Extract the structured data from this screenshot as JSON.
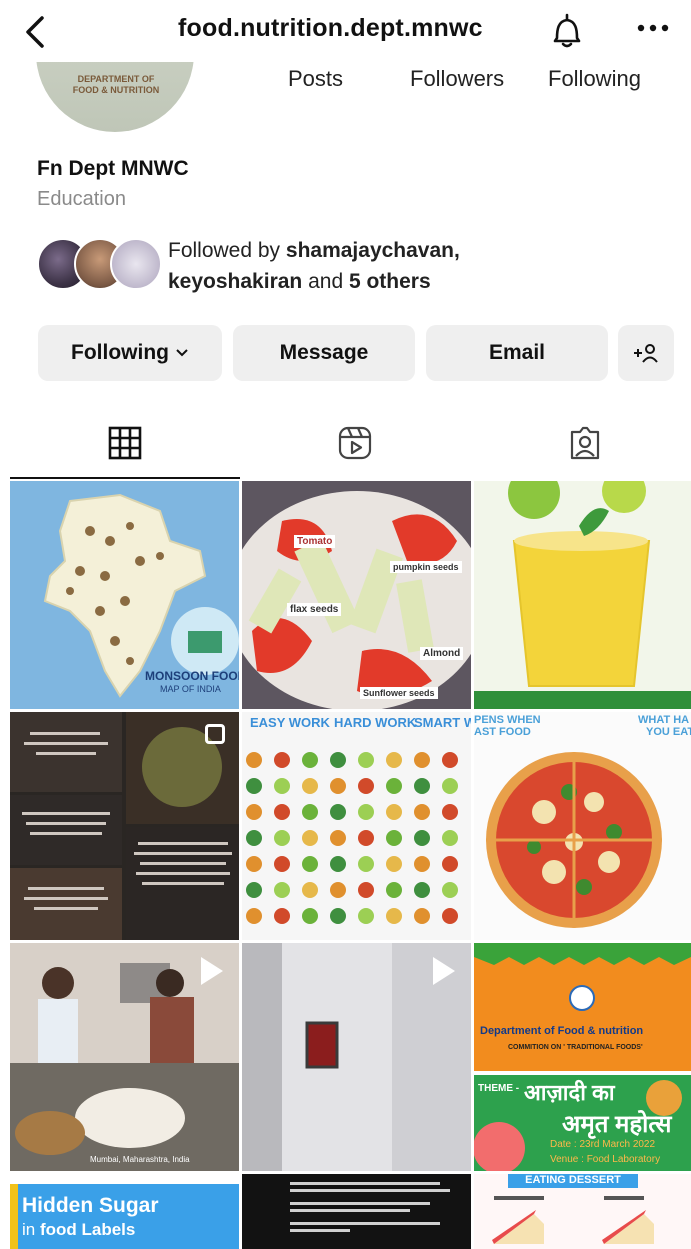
{
  "header": {
    "handle": "food.nutrition.dept.mnwc",
    "back_icon": "chevron-left-icon",
    "bell_icon": "bell-icon",
    "more_icon": "ellipsis-icon"
  },
  "profile": {
    "avatar_text_line1": "DEPARTMENT OF",
    "avatar_text_line2": "FOOD & NUTRITION",
    "stats": {
      "posts_label": "Posts",
      "followers_label": "Followers",
      "following_label": "Following"
    },
    "name": "Fn Dept MNWC",
    "category": "Education",
    "followed_by": {
      "prefix": "Followed by ",
      "user1": "shamajaychavan",
      "sep": ",",
      "user2": "keyoshakiran",
      "middle": " and ",
      "others": "5 others"
    }
  },
  "actions": {
    "following_label": "Following",
    "message_label": "Message",
    "email_label": "Email",
    "add_user_glyph": "+ደ"
  },
  "tabs": [
    {
      "name": "grid",
      "icon": "grid-icon",
      "active": true
    },
    {
      "name": "reels",
      "icon": "reels-icon",
      "active": false
    },
    {
      "name": "tagged",
      "icon": "tagged-user-icon",
      "active": false
    }
  ],
  "posts": {
    "p1_caption_line1": "MONSOON FOOD",
    "p1_caption_line2": "MAP OF INDIA",
    "p2_label1": "Tomato",
    "p2_label2": "flax seeds",
    "p2_label3": "pumpkin seeds",
    "p2_label4": "Almond",
    "p2_label5": "Sunflower seeds",
    "p5_col1": "EASY WORK",
    "p5_col2": "HARD WORK",
    "p5_col3": "SMART WORK",
    "p6_text1": "PENS WHEN",
    "p6_text2": "AST FOOD",
    "p6_text3": "WHAT HA",
    "p6_text4": "YOU EAT",
    "p7_caption": "Mumbai, Maharashtra, India",
    "p9_title": "Department of Food & nutrition",
    "p9_sub": "COMMITION ON ' TRADITIONAL FOODS'",
    "p9_theme": "THEME -",
    "p9_hindi1": "आज़ादी का",
    "p9_hindi2": "अमृत महोत्स",
    "p9_date": "Date : 23rd March 2022",
    "p9_venue": "Venue : Food Laboratory",
    "p10_line1": "Hidden Sugar",
    "p10_line2_a": "in",
    "p10_line2_b": " food Labels",
    "p12_title": "EATING DESSERT"
  },
  "colors": {
    "button_bg": "#efefef",
    "muted_text": "#8a8a8a",
    "text": "#111111"
  }
}
